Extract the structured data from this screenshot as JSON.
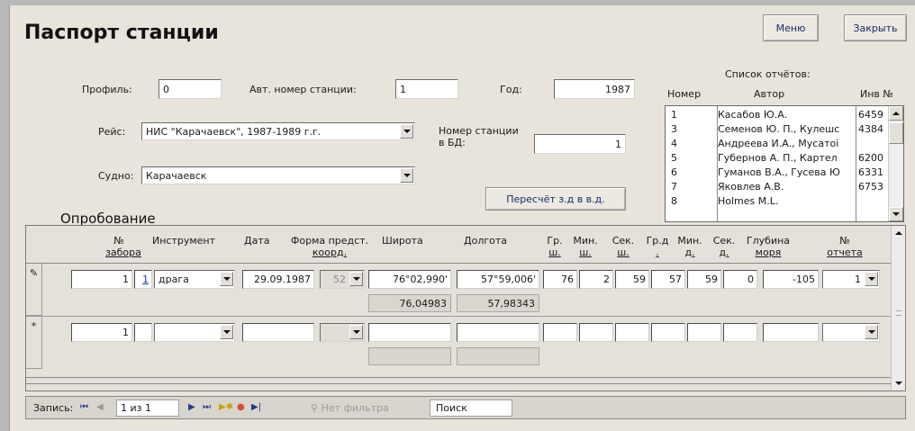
{
  "form": {
    "title": "Паспорт станции",
    "menu_label": "Меню",
    "close_label": "Закрыть"
  },
  "fields": {
    "profile_label": "Профиль:",
    "profile_value": "0",
    "auto_station_label": "Авт. номер станции:",
    "auto_station_value": "1",
    "year_label": "Год:",
    "year_value": "1987",
    "cruise_label": "Рейс:",
    "cruise_value": "НИС \"Карачаевск\", 1987-1989 г.г.",
    "vessel_label": "Судно:",
    "vessel_value": "Карачаевск",
    "db_station_label_1": "Номер станции",
    "db_station_label_2": "в БД:",
    "db_station_value": "1",
    "recalc_label": "Пересчёт з.д в в.д."
  },
  "reports": {
    "title": "Список отчётов:",
    "columns": [
      "Номер",
      "Автор",
      "Инв №"
    ],
    "rows": [
      {
        "num": "1",
        "author": "Касабов Ю.А.",
        "inv": "6459"
      },
      {
        "num": "3",
        "author": "Семенов Ю. П., Кулешс",
        "inv": "4384"
      },
      {
        "num": "4",
        "author": "Андреева И.А., Мусатоі",
        "inv": ""
      },
      {
        "num": "5",
        "author": "Губернов А. П., Картел",
        "inv": "6200"
      },
      {
        "num": "6",
        "author": "Гуманов В.А., Гусева Ю",
        "inv": "6331"
      },
      {
        "num": "7",
        "author": "Яковлев А.В.",
        "inv": "6753"
      },
      {
        "num": "8",
        "author": "Holmes M.L.",
        "inv": ""
      }
    ]
  },
  "sampling": {
    "section_title": "Опробование",
    "headers": {
      "sample_no_1": "№",
      "sample_no_2": "забора",
      "instrument": "Инструмент",
      "date": "Дата",
      "coord_form_1": "Форма предст.",
      "coord_form_2": "коорд.",
      "latitude": "Широта",
      "longitude": "Долгота",
      "lat_deg_1": "Гр.",
      "lat_deg_2": "ш.",
      "lat_min_1": "Мин.",
      "lat_min_2": "ш.",
      "lat_sec_1": "Сек.",
      "lat_sec_2": "ш.",
      "lon_deg_1": "Гр.д",
      "lon_deg_2": ".",
      "lon_min_1": "Мин.",
      "lon_min_2": "д.",
      "lon_sec_1": "Сек.",
      "lon_sec_2": "д.",
      "depth_1": "Глубина",
      "depth_2": "моря",
      "report_no_1": "№",
      "report_no_2": "отчета"
    },
    "row": {
      "sample_no": "1",
      "link": "1",
      "instrument": "драга",
      "date": "29.09.1987",
      "coord_form": "52",
      "latitude": "76°02,990'",
      "longitude": "57°59,006'",
      "lat_deg": "76",
      "lat_min": "2",
      "lat_sec": "59",
      "lon_deg": "57",
      "lon_min": "59",
      "lon_sec": "0",
      "depth": "-105",
      "report_no": "1",
      "lat_decimal": "76,04983",
      "lon_decimal": "57,98343"
    },
    "new_row": {
      "sample_no": "1",
      "marker": "*"
    },
    "edit_marker": "✎"
  },
  "navigation": {
    "record_label": "Запись:",
    "record_value": "1 из 1",
    "filter_label": "Нет фильтра",
    "search_label": "Поиск"
  }
}
